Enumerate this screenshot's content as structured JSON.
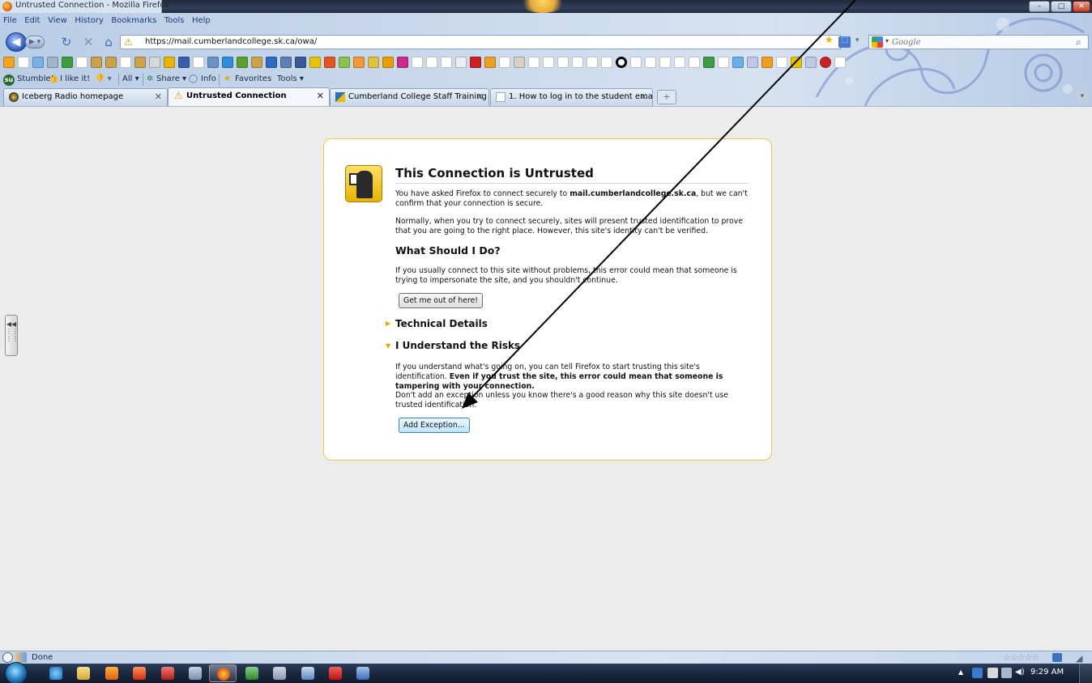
{
  "window": {
    "title": "Untrusted Connection - Mozilla Firefox",
    "controls": {
      "minimize": "–",
      "maximize": "□",
      "close": "✕"
    }
  },
  "menu": [
    "File",
    "Edit",
    "View",
    "History",
    "Bookmarks",
    "Tools",
    "Help"
  ],
  "nav": {
    "back_icon": "back-arrow-icon",
    "url": "https://mail.cumberlandcollege.sk.ca/owa/",
    "search_placeholder": "Google"
  },
  "stumble_toolbar": {
    "stumble": "Stumble!",
    "like": "I like it!",
    "all": "All",
    "share": "Share",
    "info": "Info",
    "favorites": "Favorites",
    "tools": "Tools"
  },
  "tabs": [
    {
      "label": "Iceberg Radio homepage",
      "selected": false
    },
    {
      "label": "Untrusted Connection",
      "selected": true
    },
    {
      "label": "Cumberland College Staff Training ...",
      "selected": false
    },
    {
      "label": "1. How to log in to the student ema...",
      "selected": false
    }
  ],
  "error_page": {
    "title": "This Connection is Untrusted",
    "intro_prefix": "You have asked Firefox to connect securely to ",
    "intro_host": "mail.cumberlandcollege.sk.ca",
    "intro_suffix": ", but we can't confirm that your connection is secure.",
    "normally": "Normally, when you try to connect securely, sites will present trusted identification to prove that you are going to the right place. However, this site's identity can't be verified.",
    "what_heading": "What Should I Do?",
    "what_text": "If you usually connect to this site without problems, this error could mean that someone is trying to impersonate the site, and you shouldn't continue.",
    "get_out_button": "Get me out of here!",
    "technical_heading": "Technical Details",
    "risks_heading": "I Understand the Risks",
    "risks_text_prefix": "If you understand what's going on, you can tell Firefox to start trusting this site's identification. ",
    "risks_text_bold": "Even if you trust the site, this error could mean that someone is tampering with your connection.",
    "dont_add_text": "Don't add an exception unless you know there's a good reason why this site doesn't use trusted identification.",
    "add_exception_button": "Add Exception..."
  },
  "status": {
    "text": "Done"
  },
  "taskbar": {
    "clock": "9:29 AM"
  },
  "colors": {
    "box_border": "#f0c44a",
    "warning_yellow": "#e7b400",
    "arrow": "#000000"
  }
}
